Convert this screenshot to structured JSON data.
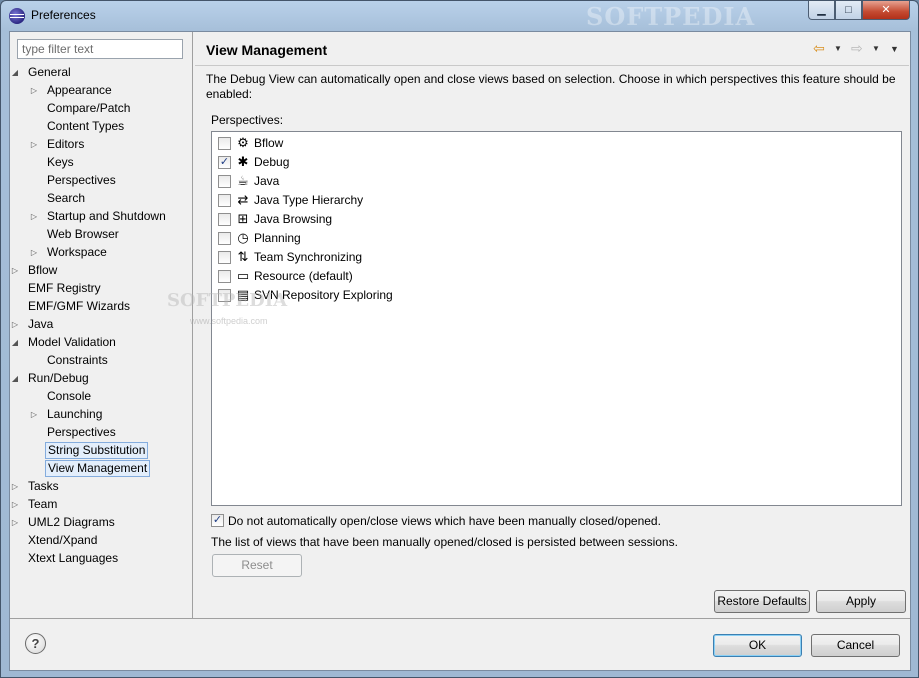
{
  "window": {
    "title": "Preferences",
    "watermark": "SOFTPEDIA",
    "controls": {
      "minimize": "▁",
      "maximize": "□",
      "close": "✕"
    }
  },
  "filter": {
    "placeholder": "type filter text",
    "value": ""
  },
  "tree": [
    {
      "label": "General",
      "depth": 0,
      "toggle": "expanded"
    },
    {
      "label": "Appearance",
      "depth": 1,
      "toggle": "collapsed"
    },
    {
      "label": "Compare/Patch",
      "depth": 1,
      "toggle": "none"
    },
    {
      "label": "Content Types",
      "depth": 1,
      "toggle": "none"
    },
    {
      "label": "Editors",
      "depth": 1,
      "toggle": "collapsed"
    },
    {
      "label": "Keys",
      "depth": 1,
      "toggle": "none"
    },
    {
      "label": "Perspectives",
      "depth": 1,
      "toggle": "none"
    },
    {
      "label": "Search",
      "depth": 1,
      "toggle": "none"
    },
    {
      "label": "Startup and Shutdown",
      "depth": 1,
      "toggle": "collapsed"
    },
    {
      "label": "Web Browser",
      "depth": 1,
      "toggle": "none"
    },
    {
      "label": "Workspace",
      "depth": 1,
      "toggle": "collapsed"
    },
    {
      "label": "Bflow",
      "depth": 0,
      "toggle": "collapsed"
    },
    {
      "label": "EMF Registry",
      "depth": 0,
      "toggle": "none"
    },
    {
      "label": "EMF/GMF Wizards",
      "depth": 0,
      "toggle": "none"
    },
    {
      "label": "Java",
      "depth": 0,
      "toggle": "collapsed"
    },
    {
      "label": "Model Validation",
      "depth": 0,
      "toggle": "expanded"
    },
    {
      "label": "Constraints",
      "depth": 1,
      "toggle": "none"
    },
    {
      "label": "Run/Debug",
      "depth": 0,
      "toggle": "expanded"
    },
    {
      "label": "Console",
      "depth": 1,
      "toggle": "none"
    },
    {
      "label": "Launching",
      "depth": 1,
      "toggle": "collapsed"
    },
    {
      "label": "Perspectives",
      "depth": 1,
      "toggle": "none"
    },
    {
      "label": "String Substitution",
      "depth": 1,
      "toggle": "none",
      "state": "hilite"
    },
    {
      "label": "View Management",
      "depth": 1,
      "toggle": "none",
      "state": "selected"
    },
    {
      "label": "Tasks",
      "depth": 0,
      "toggle": "collapsed"
    },
    {
      "label": "Team",
      "depth": 0,
      "toggle": "collapsed"
    },
    {
      "label": "UML2 Diagrams",
      "depth": 0,
      "toggle": "collapsed"
    },
    {
      "label": "Xtend/Xpand",
      "depth": 0,
      "toggle": "none"
    },
    {
      "label": "Xtext Languages",
      "depth": 0,
      "toggle": "none"
    }
  ],
  "page": {
    "title": "View Management",
    "description": "The Debug View can automatically open and close views based on selection. Choose in which perspectives this feature should be enabled:",
    "perspectives_label": "Perspectives:",
    "perspectives": [
      {
        "label": "Bflow",
        "checked": false,
        "icon": "gears-icon",
        "glyph": "⚙"
      },
      {
        "label": "Debug",
        "checked": true,
        "icon": "bug-icon",
        "glyph": "✱"
      },
      {
        "label": "Java",
        "checked": false,
        "icon": "java-perspective-icon",
        "glyph": "☕"
      },
      {
        "label": "Java Type Hierarchy",
        "checked": false,
        "icon": "type-hierarchy-icon",
        "glyph": "⇄"
      },
      {
        "label": "Java Browsing",
        "checked": false,
        "icon": "java-browsing-icon",
        "glyph": "⊞"
      },
      {
        "label": "Planning",
        "checked": false,
        "icon": "clock-icon",
        "glyph": "◷"
      },
      {
        "label": "Team Synchronizing",
        "checked": false,
        "icon": "team-sync-icon",
        "glyph": "⇅"
      },
      {
        "label": "Resource (default)",
        "checked": false,
        "icon": "folder-icon",
        "glyph": "▭"
      },
      {
        "label": "SVN Repository Exploring",
        "checked": false,
        "icon": "svn-icon",
        "glyph": "▤"
      }
    ],
    "option_label": "Do not automatically open/close views which have been manually closed/opened.",
    "option_checked": true,
    "note": "The list of views that have been manually opened/closed is persisted between sessions.",
    "reset_label": "Reset",
    "watermark_text": "SOFTPEDIA",
    "watermark_url": "www.softpedia.com"
  },
  "buttons": {
    "restore_defaults": "Restore Defaults",
    "apply": "Apply",
    "ok": "OK",
    "cancel": "Cancel",
    "help": "?"
  },
  "nav": {
    "back": "⇦",
    "forward": "⇨",
    "dropdown": "▼",
    "menu": "▼"
  }
}
